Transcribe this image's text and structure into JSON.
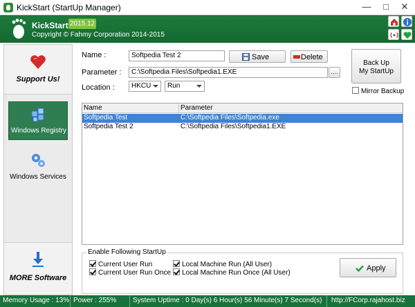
{
  "window": {
    "title": "KickStart (StartUp Manager)"
  },
  "header": {
    "app_name": "KickStart",
    "version": "2015.12",
    "copyright": "Copyright © Fahmy Corporation 2014-2015"
  },
  "sidebar": {
    "support": "Support Us!",
    "registry": "Windows Registry",
    "services": "Windows Services",
    "more": "MORE Software"
  },
  "form": {
    "name_label": "Name :",
    "name_value": "Softpedia Test 2",
    "save_label": "Save",
    "delete_label": "Delete",
    "parameter_label": "Parameter :",
    "parameter_value": "C:\\Softpedia Files\\Softpedia1.EXE",
    "browse_label": "....",
    "location_label": "Location :",
    "hive_value": "HKCU",
    "key_value": "Run",
    "backup_label_1": "Back Up",
    "backup_label_2": "My StartUp",
    "mirror_label": "Mirror Backup"
  },
  "table": {
    "columns": [
      "Name",
      "Parameter"
    ],
    "rows": [
      {
        "name": "Softpedia Test",
        "parameter": "C:\\Softpedia Files\\Softpedia.exe",
        "selected": true
      },
      {
        "name": "Softpedia Test 2",
        "parameter": "C:\\Softpedia Files\\Softpedia1.EXE",
        "selected": false
      }
    ]
  },
  "startup": {
    "title": "Enable Following StartUp",
    "current_user_run": "Current User Run",
    "current_user_run_once": "Current User Run Once",
    "local_machine_run": "Local Machine Run (All User)",
    "local_machine_run_once": "Local Machine Run Once (All User)",
    "apply_label": "Apply"
  },
  "status": {
    "memory": "Memory Usage : 13%",
    "power": "Power : 255%",
    "uptime": "System Uptime : 0 Day(s) 6 Hour(s) 56 Minute(s) 7 Second(s)",
    "url": "http://FCorp.rajahost.biz"
  },
  "colors": {
    "brand_green": "#1d7a3c",
    "selection_blue": "#3c84d6",
    "version_badge": "#7fc242"
  }
}
